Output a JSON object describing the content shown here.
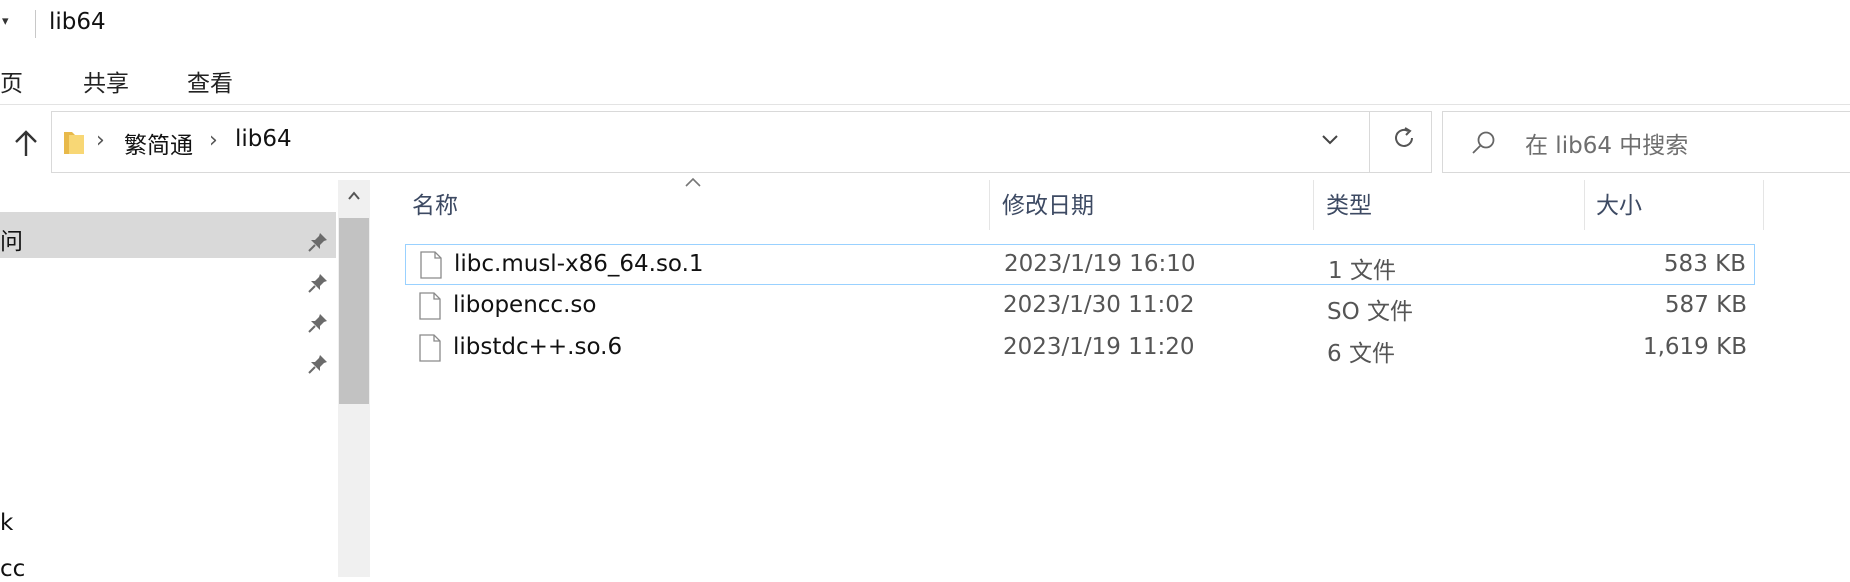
{
  "window": {
    "title": "lib64",
    "quick_access_dropdown": "▾"
  },
  "ribbon": {
    "tabs": [
      "主页",
      "共享",
      "查看"
    ],
    "visible_fragment": "页"
  },
  "address_bar": {
    "breadcrumbs": [
      "繁简通",
      "lib64"
    ],
    "separator": "›"
  },
  "search": {
    "placeholder": "在 lib64 中搜索"
  },
  "nav_pane": {
    "selected_item_fragment": "问",
    "item_fragments": [
      "k",
      "cc"
    ],
    "pinned_count": 4
  },
  "columns": {
    "name": "名称",
    "date": "修改日期",
    "type": "类型",
    "size": "大小"
  },
  "files": [
    {
      "name": "libc.musl-x86_64.so.1",
      "date": "2023/1/19 16:10",
      "type": "1 文件",
      "size": "583 KB"
    },
    {
      "name": "libopencc.so",
      "date": "2023/1/30 11:02",
      "type": "SO 文件",
      "size": "587 KB"
    },
    {
      "name": "libstdc++.so.6",
      "date": "2023/1/19 11:20",
      "type": "6 文件",
      "size": "1,619 KB"
    }
  ],
  "colors": {
    "selection_border": "#99d1ff",
    "header_text": "#3d4a63",
    "folder_yellow": "#f8d775"
  }
}
